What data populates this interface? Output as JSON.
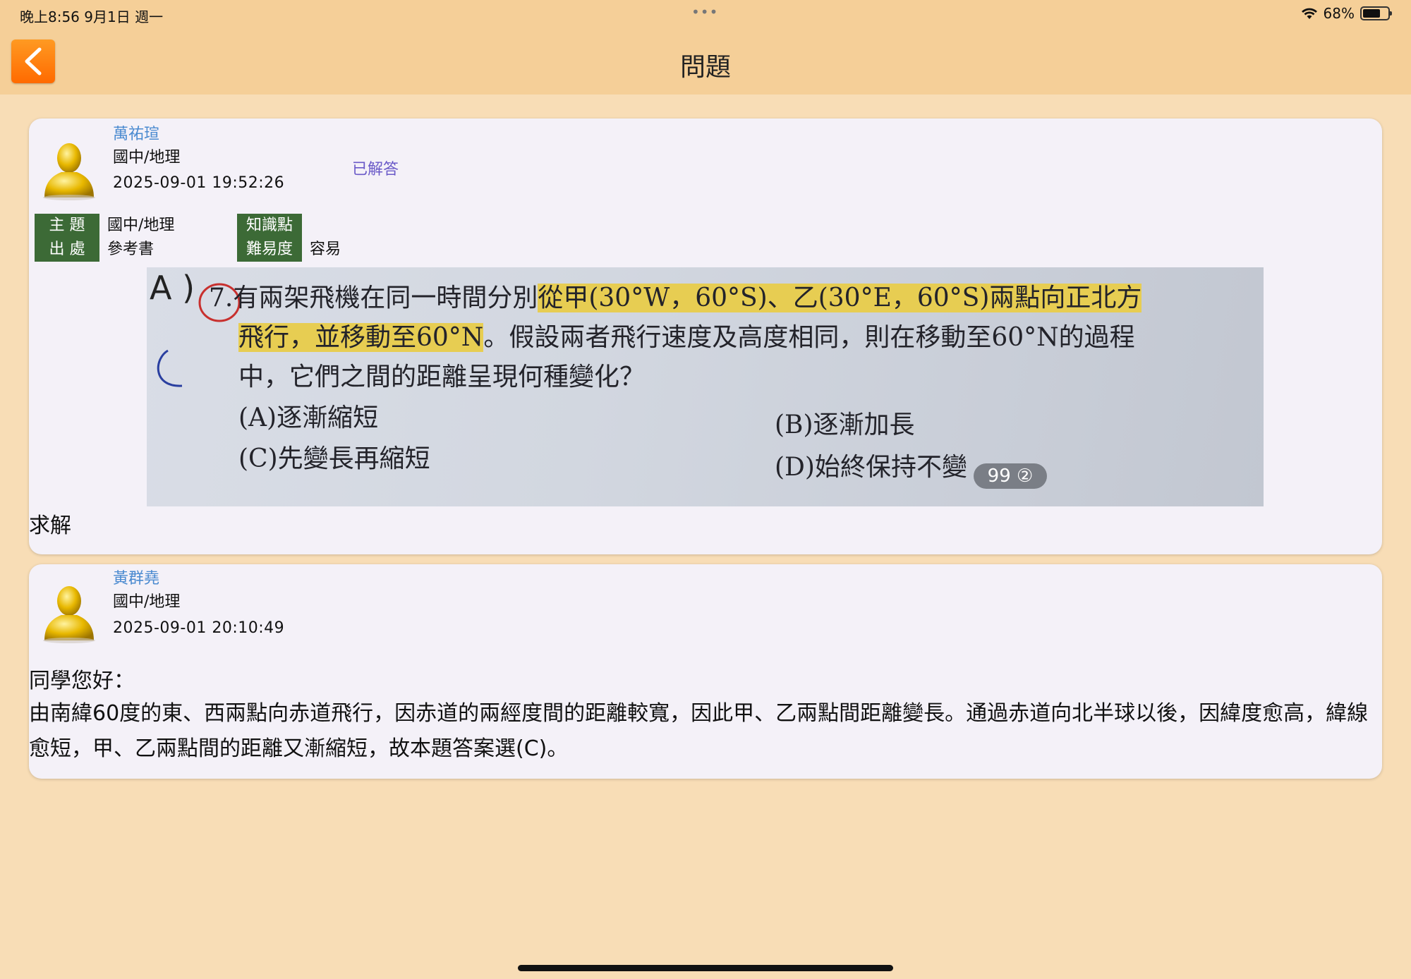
{
  "status_bar": {
    "time": "晚上8:56   9月1日 週一",
    "dots": "•••",
    "battery": "68%"
  },
  "nav": {
    "title": "問題",
    "back_icon": "chevron-left-icon"
  },
  "question": {
    "author": "萬祐瑄",
    "subject": "國中/地理",
    "time": "2025-09-01 19:52:26",
    "status": "已解答",
    "tags": {
      "topic_label": "主  題",
      "topic_value": "國中/地理",
      "source_label": "出  處",
      "source_value": "參考書",
      "knowledge_label": "知識點",
      "knowledge_value": "",
      "difficulty_label": "難易度",
      "difficulty_value": "容易"
    },
    "photo": {
      "handwriting_a": "A )",
      "handwriting_c": "C",
      "line1_pre": "7.有兩架飛機在同一時間分別",
      "line1_hl": "從甲(30°W，60°S)、乙(30°E，60°S)兩點向正北方",
      "line2_hl": "飛行，並移動至60°N",
      "line2_post": "。假設兩者飛行速度及高度相同，則在移動至60°N的過程",
      "line3": "中，它們之間的距離呈現何種變化？",
      "option_a": "(A)逐漸縮短",
      "option_b": "(B)逐漸加長",
      "option_c": "(C)先變長再縮短",
      "option_d": "(D)始終保持不變",
      "badge": "99 ②"
    },
    "body": "求解"
  },
  "answer": {
    "author": "黃群堯",
    "subject": "國中/地理",
    "time": "2025-09-01 20:10:49",
    "greeting": "同學您好：",
    "body": "由南緯60度的東、西兩點向赤道飛行，因赤道的兩經度間的距離較寬，因此甲、乙兩點間距離變長。通過赤道向北半球以後，因緯度愈高，緯線愈短，甲、乙兩點間的距離又漸縮短，故本題答案選(C)。"
  },
  "colors": {
    "background": "#f8ddb6",
    "nav_bar": "#f5cf98",
    "back_button": "#ff7a10",
    "author_name": "#4a8ad0",
    "status_badge": "#6a5ac8",
    "tag_label": "#3c6a36",
    "highlight": "#e7cd52"
  }
}
